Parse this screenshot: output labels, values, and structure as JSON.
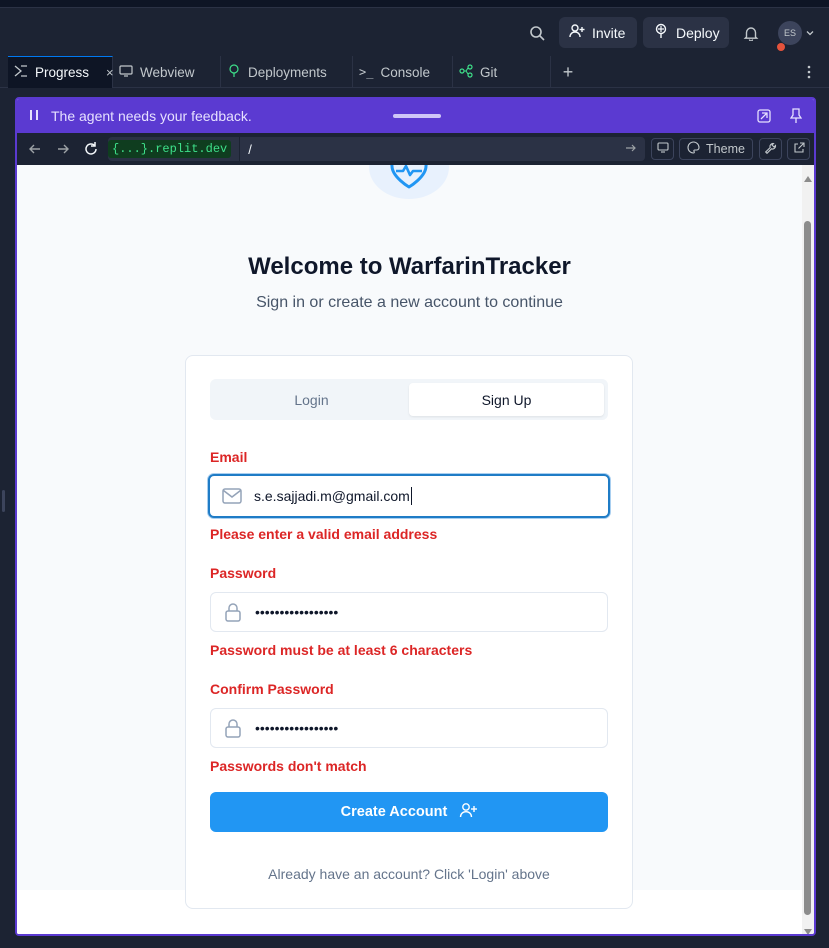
{
  "topbar": {
    "invite_label": "Invite",
    "deploy_label": "Deploy",
    "avatar_initials": "ES"
  },
  "tabs": [
    {
      "label": "Progress"
    },
    {
      "label": "Webview"
    },
    {
      "label": "Deployments"
    },
    {
      "label": "Console"
    },
    {
      "label": "Git"
    }
  ],
  "feedback_bar": {
    "text": "The agent needs your feedback."
  },
  "browser": {
    "domain": "{...}.replit.dev",
    "path": "/",
    "theme_label": "Theme"
  },
  "auth": {
    "title": "Welcome to WarfarinTracker",
    "subtitle": "Sign in or create a new account to continue",
    "tab_login": "Login",
    "tab_signup": "Sign Up",
    "email_label": "Email",
    "email_value": "s.e.sajjadi.m@gmail.com",
    "email_error": "Please enter a valid email address",
    "password_label": "Password",
    "password_value": "•••••••••••••••••",
    "password_error": "Password must be at least 6 characters",
    "confirm_label": "Confirm Password",
    "confirm_value": "•••••••••••••••••",
    "confirm_error": "Passwords don't match",
    "submit_label": "Create Account",
    "footer_text": "Already have an account? Click 'Login' above"
  },
  "colors": {
    "accent_purple": "#5b3ad1",
    "primary_blue": "#2196f3",
    "error_red": "#dc2626"
  }
}
